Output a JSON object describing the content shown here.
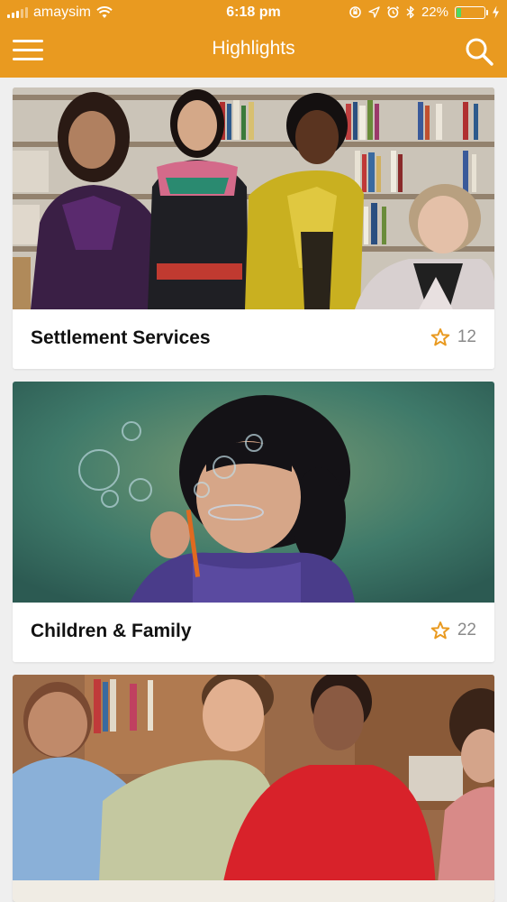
{
  "status_bar": {
    "carrier": "amaysim",
    "time": "6:18 pm",
    "battery_percent": "22%",
    "battery_level": 0.22,
    "icons": [
      "signal-icon",
      "wifi-icon",
      "orientation-lock-icon",
      "location-icon",
      "alarm-icon",
      "bluetooth-icon",
      "battery-icon",
      "charging-icon"
    ]
  },
  "navbar": {
    "title": "Highlights",
    "menu_icon": "hamburger-menu-icon",
    "search_icon": "search-icon"
  },
  "colors": {
    "brand": "#e99a20",
    "star": "#e99a20",
    "battery": "#4cd964"
  },
  "cards": [
    {
      "title": "Settlement Services",
      "count": "12",
      "icon": "star-icon",
      "image": "group of four smiling women in a library"
    },
    {
      "title": "Children & Family",
      "count": "22",
      "icon": "star-icon",
      "image": "young girl blowing soap bubbles"
    },
    {
      "title": "",
      "count": "",
      "icon": "",
      "image": "adults studying together at a table in a library"
    }
  ]
}
